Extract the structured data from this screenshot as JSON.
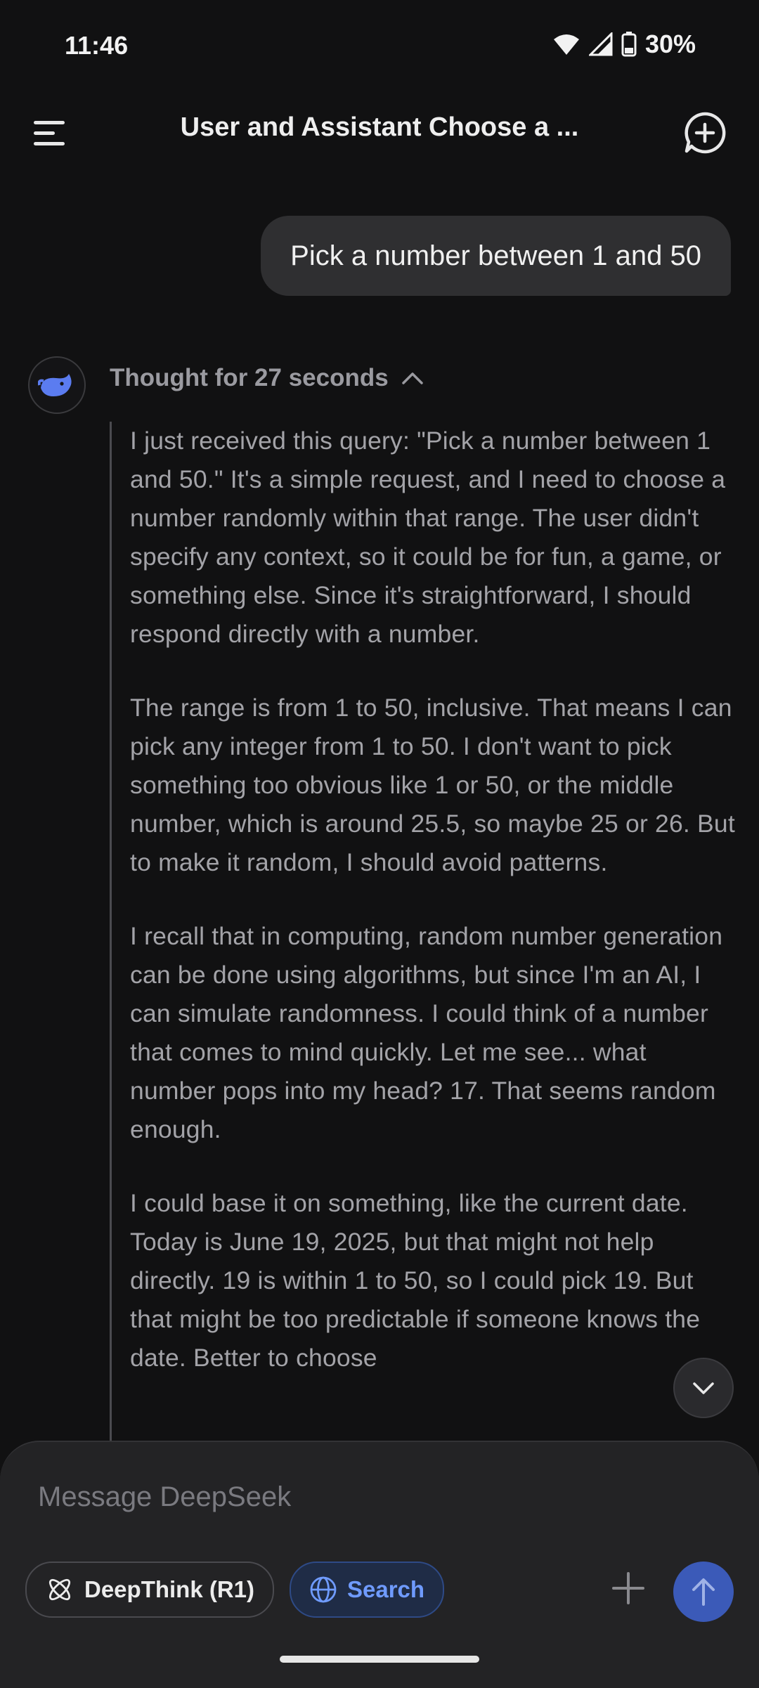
{
  "status_bar": {
    "time": "11:46",
    "battery": "30%"
  },
  "header": {
    "title": "User and Assistant Choose a ..."
  },
  "user_message": {
    "text": "Pick a number between 1 and 50"
  },
  "assistant": {
    "thought_label": "Thought for 27 seconds",
    "paragraphs": [
      "I just received this query: \"Pick a number between 1 and 50.\" It's a simple request, and I need to choose a number randomly within that range. The user didn't specify any context, so it could be for fun, a game, or something else. Since it's straightforward, I should respond directly with a number.",
      "The range is from 1 to 50, inclusive. That means I can pick any integer from 1 to 50. I don't want to pick something too obvious like 1 or 50, or the middle number, which is around 25.5, so maybe 25 or 26. But to make it random, I should avoid patterns.",
      "I recall that in computing, random number generation can be done using algorithms, but since I'm an AI, I can simulate randomness. I could think of a number that comes to mind quickly. Let me see... what number pops into my head? 17. That seems random enough.",
      "I could base it on something, like the current date. Today is June 19, 2025, but that might not help directly. 19 is within 1 to 50, so I could pick 19. But that might be too predictable if someone knows the date. Better to choose"
    ]
  },
  "composer": {
    "placeholder": "Message DeepSeek",
    "deepthink_label": "DeepThink (R1)",
    "search_label": "Search"
  },
  "colors": {
    "accent": "#3b5ab8",
    "search_text": "#6f9bff",
    "background": "#111112"
  },
  "icons": [
    "menu-icon",
    "new-chat-icon",
    "deepseek-whale-icon",
    "chevron-up-icon",
    "chevron-down-icon",
    "atom-icon",
    "globe-icon",
    "plus-icon",
    "arrow-up-icon",
    "wifi-icon",
    "signal-icon",
    "battery-icon"
  ]
}
